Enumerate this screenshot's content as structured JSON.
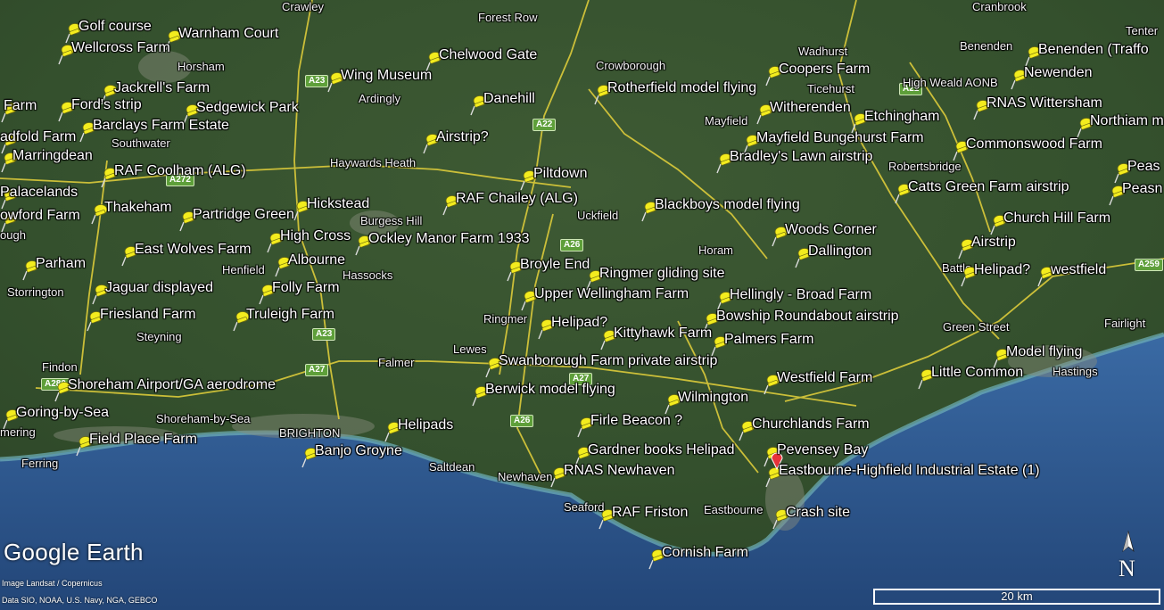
{
  "map": {
    "colors": {
      "land": "#36522f",
      "sea": "#2c528e",
      "coast": "#5f9aa3",
      "road": "#e6d23b",
      "pin": "#f3ec1e"
    },
    "attribution": {
      "logo": "Google Earth",
      "imagery": "Image Landsat / Copernicus",
      "data": "Data SIO, NOAA, U.S. Navy, NGA, GEBCO"
    },
    "compass_label": "N",
    "scale_label": "20 km"
  },
  "markers": [
    "Golf course",
    "Warnham Court",
    "Wellcross Farm",
    "Wing Museum",
    "Jackrell's Farm",
    "Ford's strip",
    "Sedgewick Park",
    "Barclays Farm Estate",
    "Farm",
    "adfold Farm",
    "Marringdean",
    "RAF Coolham (ALG)",
    "Palacelands",
    "owford Farm",
    "Thakeham",
    "Partridge Green",
    "Hickstead",
    "High Cross",
    "East Wolves Farm",
    "Albourne",
    "Parham",
    "Jaguar displayed",
    "Folly Farm",
    "Friesland Farm",
    "Truleigh Farm",
    "Shoreham Airport/GA aerodrome",
    "Goring-by-Sea",
    "Field Place Farm",
    "Helipads",
    "Banjo Groyne",
    "Chelwood Gate",
    "Danehill",
    "Airstrip?",
    "Piltdown",
    "RAF Chailey (ALG)",
    "Ockley Manor Farm 1933",
    "Broyle End",
    "Ringmer gliding site",
    "Upper Wellingham Farm",
    "Helipad?",
    "Kittyhawk Farm",
    "Swanborough Farm private airstrip",
    "Berwick model flying",
    "Wilmington",
    "Firle Beacon ?",
    "RNAS Newhaven",
    "RAF Friston",
    "Cornish Farm",
    "Crash site",
    "Gardner books Helipad",
    "Pevensey Bay",
    "Eastbourne-Highfield Industrial Estate (1)",
    "Churchlands Farm",
    "Westfield Farm",
    "Palmers Farm",
    "Bowship Roundabout airstrip",
    "Hellingly - Broad Farm",
    "Blackboys model flying",
    "Rotherfield model flying",
    "Coopers Farm",
    "Witherenden",
    "Mayfield Bungehurst Farm",
    "Bradley's Lawn airstrip",
    "Woods Corner",
    "Dallington",
    "Etchingham",
    "Benenden (Traffo",
    "Newenden",
    "RNAS Wittersham",
    "Northiam m",
    "Commonswood Farm",
    "Peas",
    "Peasn",
    "Catts Green Farm airstrip",
    "Church Hill Farm",
    "Airstrip",
    "Helipad?",
    "westfield",
    "Model flying",
    "Little Common"
  ],
  "places": [
    "Crawley",
    "Forest Row",
    "Cranbrook",
    "Tenter",
    "Horsham",
    "Ardingly",
    "Crowborough",
    "Wadhurst",
    "Ticehurst",
    "High Weald AONB",
    "Benenden",
    "Mayfield",
    "Southwater",
    "Haywards Heath",
    "Robertsbridge",
    "Uckfield",
    "Burgess Hill",
    "Horam",
    "ough",
    "Henfield",
    "Hassocks",
    "Battle",
    "Storrington",
    "Ringmer",
    "Green Street",
    "Fairlight",
    "Steyning",
    "Lewes",
    "Falmer",
    "Findon",
    "Hastings",
    "Shoreham-by-Sea",
    "BRIGHTON",
    "mering",
    "Ferring",
    "Saltdean",
    "Newhaven",
    "Seaford",
    "Eastbourne"
  ],
  "roads": [
    "A23",
    "A22",
    "A272",
    "A26",
    "A23",
    "A27",
    "A280",
    "A27",
    "A26",
    "A259",
    "A21"
  ]
}
